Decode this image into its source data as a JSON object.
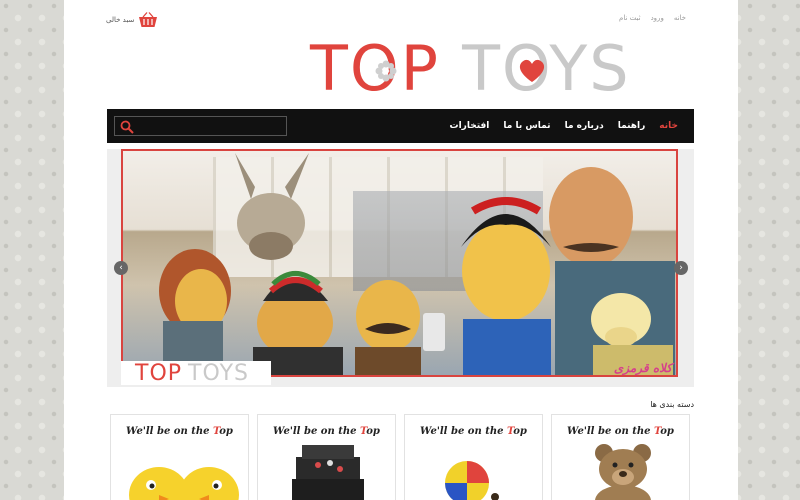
{
  "header": {
    "links": [
      "خانه",
      "ورود",
      "ثبت نام"
    ],
    "cart_label": "سبد خالی",
    "logo": {
      "word1": "TOP",
      "word2": "TOYS"
    }
  },
  "nav": {
    "items": [
      "خانه",
      "راهنما",
      "درباره ما",
      "تماس با ما",
      "افتخارات"
    ],
    "active_index": 0,
    "search_placeholder": ""
  },
  "slider": {
    "caption_word1": "TOP",
    "caption_word2": "TOYS",
    "brand_text": "کلاه قرمزی",
    "prev_icon": "chevron-left-icon",
    "next_icon": "chevron-right-icon"
  },
  "categories": {
    "title": "دسته بندی ها",
    "cards": [
      {
        "tag_pre": "We'll be on the ",
        "tag_accent": "T",
        "tag_post": "op",
        "image": "plush-chicks"
      },
      {
        "tag_pre": "We'll be on the ",
        "tag_accent": "T",
        "tag_post": "op",
        "image": "gift-boxes"
      },
      {
        "tag_pre": "We'll be on the ",
        "tag_accent": "T",
        "tag_post": "op",
        "image": "beach-ball"
      },
      {
        "tag_pre": "We'll be on the ",
        "tag_accent": "T",
        "tag_post": "op",
        "image": "teddy-bear"
      }
    ]
  },
  "colors": {
    "accent": "#e0443d",
    "nav_bg": "#111111",
    "logo_grey": "#c9c9c9"
  }
}
